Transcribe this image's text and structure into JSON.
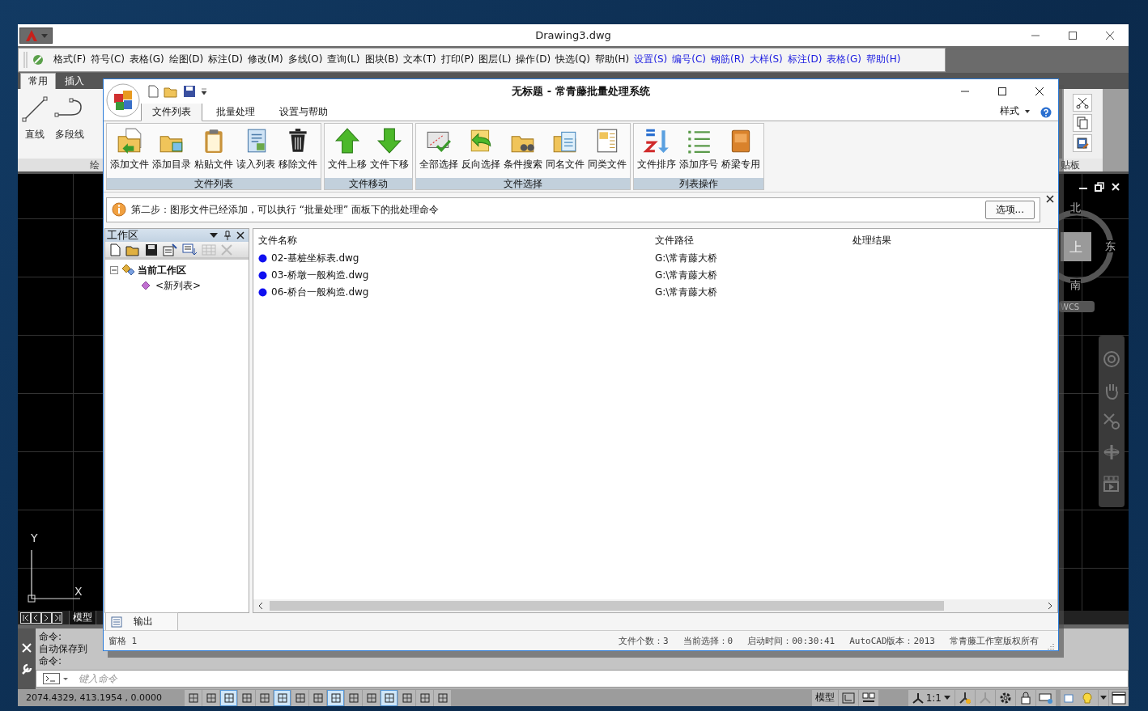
{
  "cad": {
    "title": "Drawing3.dwg",
    "menus": [
      {
        "label": "格式(F)",
        "kind": "standard"
      },
      {
        "label": "符号(C)",
        "kind": "standard"
      },
      {
        "label": "表格(G)",
        "kind": "standard"
      },
      {
        "label": "绘图(D)",
        "kind": "standard"
      },
      {
        "label": "标注(D)",
        "kind": "standard"
      },
      {
        "label": "修改(M)",
        "kind": "standard"
      },
      {
        "label": "多线(O)",
        "kind": "standard"
      },
      {
        "label": "查询(L)",
        "kind": "standard"
      },
      {
        "label": "图块(B)",
        "kind": "standard"
      },
      {
        "label": "文本(T)",
        "kind": "standard"
      },
      {
        "label": "打印(P)",
        "kind": "standard"
      },
      {
        "label": "图层(L)",
        "kind": "standard"
      },
      {
        "label": "操作(D)",
        "kind": "standard"
      },
      {
        "label": "快选(Q)",
        "kind": "standard"
      },
      {
        "label": "帮助(H)",
        "kind": "standard"
      },
      {
        "label": "设置(S)",
        "kind": "plugin"
      },
      {
        "label": "编号(C)",
        "kind": "plugin"
      },
      {
        "label": "钢筋(R)",
        "kind": "plugin"
      },
      {
        "label": "大样(S)",
        "kind": "plugin"
      },
      {
        "label": "标注(D)",
        "kind": "plugin"
      },
      {
        "label": "表格(G)",
        "kind": "plugin"
      },
      {
        "label": "帮助(H)",
        "kind": "plugin"
      }
    ],
    "ribbon_tabs": [
      {
        "label": "常用",
        "selected": true
      },
      {
        "label": "插入",
        "selected": false
      }
    ],
    "draw_tools": [
      "直线",
      "多段线"
    ],
    "draw_panel_label": "绘",
    "clipboard_panel_label": "贴板",
    "viewcube": {
      "north": "北",
      "top": "上",
      "east": "东",
      "south": "南",
      "ucs": "WCS"
    },
    "ucs_icon": {
      "y": "Y",
      "x": "X"
    },
    "layout_tabs": [
      {
        "label": "模型",
        "selected": true
      }
    ],
    "command_lines": [
      "命令:",
      "自动保存到",
      "命令:"
    ],
    "command_input": {
      "placeholder": "键入命令"
    },
    "coordinates": "2074.4329, 413.1954 , 0.0000",
    "status_toggles": [
      {
        "on": false
      },
      {
        "on": false
      },
      {
        "on": true
      },
      {
        "on": false
      },
      {
        "on": false
      },
      {
        "on": true
      },
      {
        "on": false
      },
      {
        "on": false
      },
      {
        "on": true
      },
      {
        "on": false
      },
      {
        "on": false
      },
      {
        "on": true
      },
      {
        "on": false
      },
      {
        "on": false
      },
      {
        "on": false
      }
    ],
    "status_model": "模型",
    "status_scale": "1:1"
  },
  "dialog": {
    "title": "无标题 - 常青藤批量处理系统",
    "tabs": [
      {
        "label": "文件列表",
        "selected": true
      },
      {
        "label": "批量处理",
        "selected": false
      },
      {
        "label": "设置与帮助",
        "selected": false
      }
    ],
    "style_menu": "样式",
    "ribbon_groups": [
      {
        "title": "文件列表",
        "tools": [
          "添加文件",
          "添加目录",
          "粘贴文件",
          "读入列表",
          "移除文件"
        ]
      },
      {
        "title": "文件移动",
        "tools": [
          "文件上移",
          "文件下移"
        ]
      },
      {
        "title": "文件选择",
        "tools": [
          "全部选择",
          "反向选择",
          "条件搜索",
          "同名文件",
          "同类文件"
        ]
      },
      {
        "title": "列表操作",
        "tools": [
          "文件排序",
          "添加序号",
          "桥梁专用"
        ]
      }
    ],
    "notice": {
      "text": "第二步：图形文件已经添加，可以执行 “批量处理” 面板下的批处理命令",
      "button": "选项..."
    },
    "workspace": {
      "title": "工作区",
      "tree": [
        {
          "label": "当前工作区",
          "expanded": true,
          "children": [
            {
              "label": "<新列表>"
            }
          ]
        }
      ]
    },
    "file_table": {
      "columns": [
        "文件名称",
        "文件路径",
        "处理结果"
      ],
      "rows": [
        {
          "name": "02-基桩坐标表.dwg",
          "path": "G:\\常青藤大桥"
        },
        {
          "name": "03-桥墩一般构造.dwg",
          "path": "G:\\常青藤大桥"
        },
        {
          "name": "06-桥台一般构造.dwg",
          "path": "G:\\常青藤大桥"
        }
      ]
    },
    "output_tab": "输出",
    "status": {
      "pane": "窗格 1",
      "items": [
        "文件个数：3",
        "当前选择：0",
        "启动时间：00:30:41",
        "AutoCAD版本：2013",
        "常青藤工作室版权所有"
      ]
    }
  }
}
